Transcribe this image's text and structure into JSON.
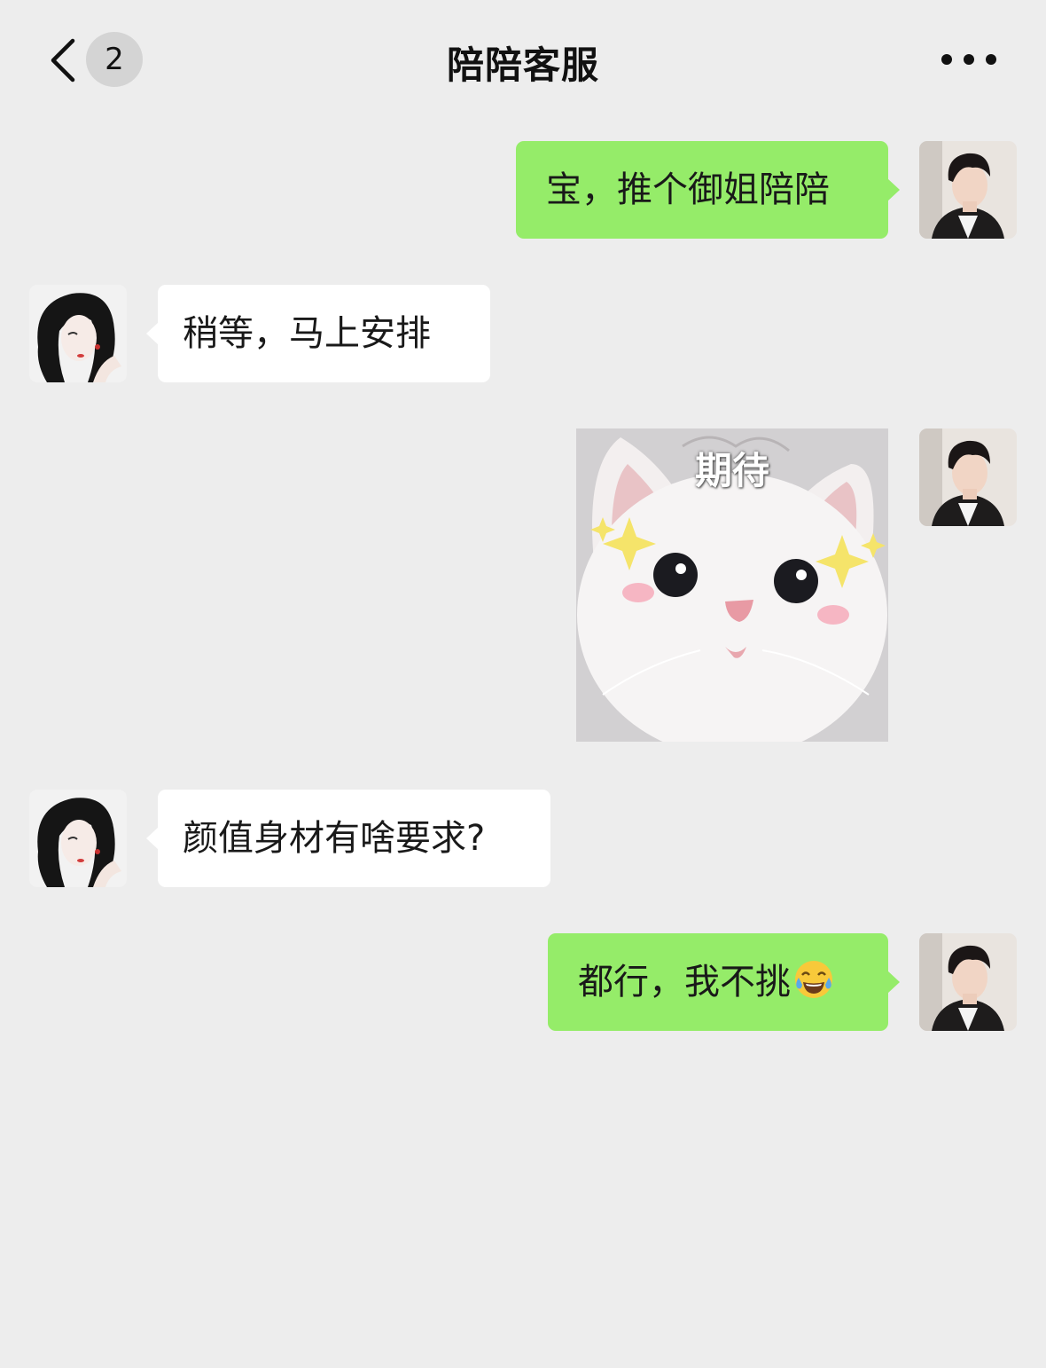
{
  "header": {
    "back_label": "back",
    "unread_count": "2",
    "title": "陪陪客服",
    "more_icon": "more-icon"
  },
  "messages": [
    {
      "sender": "me",
      "type": "text",
      "text": "宝，推个御姐陪陪"
    },
    {
      "sender": "other",
      "type": "text",
      "text": "稍等，马上安排"
    },
    {
      "sender": "me",
      "type": "sticker",
      "caption": "期待",
      "icon": "cat-sticker"
    },
    {
      "sender": "other",
      "type": "text",
      "text": "颜值身材有啥要求?"
    },
    {
      "sender": "me",
      "type": "text",
      "text": "都行，我不挑",
      "emoji": "tears-of-joy-emoji"
    }
  ],
  "colors": {
    "background": "#ededed",
    "my_bubble": "#95ec69",
    "other_bubble": "#ffffff",
    "text": "#191919"
  }
}
